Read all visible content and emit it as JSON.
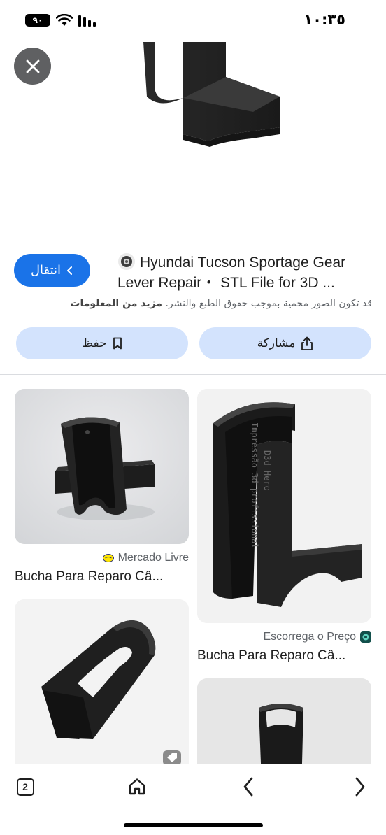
{
  "status_bar": {
    "time": "١٠:٣٥",
    "battery": "٩٠"
  },
  "result": {
    "visit_label": "انتقال",
    "title_line1": "Hyundai Tucson Sportage Gear",
    "title_line2": "Lever Repair・ STL File for 3D ...",
    "copyright_text": "قد تكون الصور محمية بموجب حقوق الطبع والنشر.",
    "learn_more": "مزيد من المعلومات"
  },
  "actions": {
    "share_label": "مشاركة",
    "save_label": "حفظ"
  },
  "related": [
    {
      "source": "Mercado Livre",
      "title": "Bucha Para Reparo Câ..."
    },
    {
      "source": "Escorrega o Preço",
      "title": "Bucha Para Reparo Câ..."
    }
  ],
  "watermark": {
    "line1": "D3d Hero",
    "line2": "Impressão 3d profissional"
  },
  "bottom_bar": {
    "tab_count": "2"
  },
  "colors": {
    "accent": "#1a73e8",
    "tonal_button": "#d3e3fd",
    "close_button": "#5f6062"
  }
}
